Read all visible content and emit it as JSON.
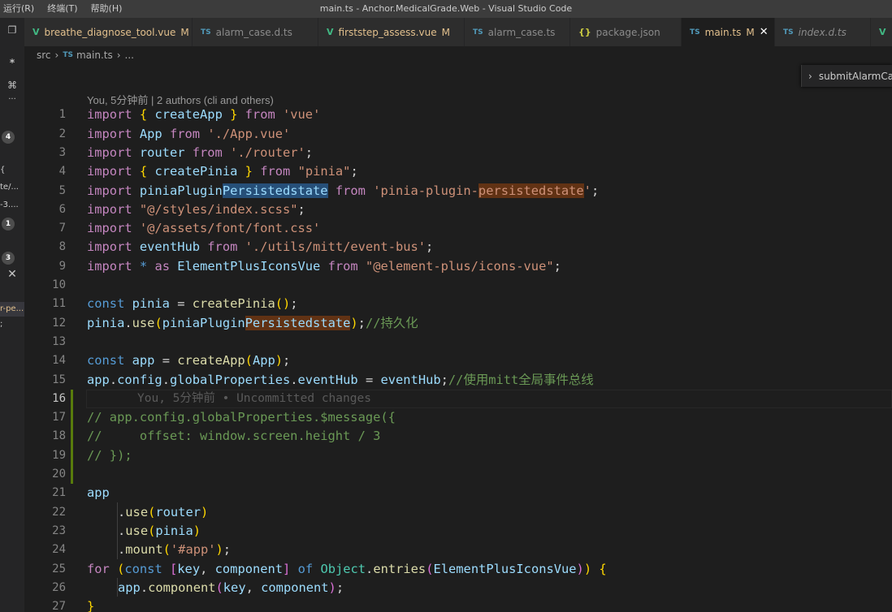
{
  "menu": [
    "运行(R)",
    "终端(T)",
    "帮助(H)"
  ],
  "window_title": "main.ts - Anchor.MedicalGrade.Web - Visual Studio Code",
  "activity": {
    "badges": [
      "4",
      "1",
      "3"
    ],
    "texts": [
      "{",
      "te/...",
      "-3....",
      "r-pe...",
      ";"
    ],
    "glyphs": [
      "copy-icon",
      "new-file-icon",
      "source-control-icon",
      "more-icon",
      "close-icon"
    ]
  },
  "tabs": [
    {
      "label": "breathe_diagnose_tool.vue",
      "icon": "V",
      "type": "vue",
      "status": "M"
    },
    {
      "label": "alarm_case.d.ts",
      "icon": "TS",
      "type": "ts",
      "status": ""
    },
    {
      "label": "firststep_assess.vue",
      "icon": "V",
      "type": "vue",
      "status": "M"
    },
    {
      "label": "alarm_case.ts",
      "icon": "TS",
      "type": "ts",
      "status": ""
    },
    {
      "label": "package.json",
      "icon": "{}",
      "type": "json",
      "status": ""
    },
    {
      "label": "main.ts",
      "icon": "TS",
      "type": "ts",
      "status": "M",
      "active": true
    },
    {
      "label": "index.d.ts",
      "icon": "TS",
      "type": "ts",
      "status": ""
    }
  ],
  "breadcrumb": {
    "folder": "src",
    "file_icon": "TS",
    "file": "main.ts",
    "more": "..."
  },
  "sticky": {
    "label": "submitAlarmCa"
  },
  "codelens": "You, 5分钟前 | 2 authors (cli and others)",
  "ghost_blame": "You, 5分钟前 • Uncommitted changes",
  "line_numbers": [
    "1",
    "2",
    "3",
    "4",
    "5",
    "6",
    "7",
    "8",
    "9",
    "10",
    "11",
    "12",
    "13",
    "14",
    "15",
    "16",
    "17",
    "18",
    "19",
    "20",
    "21",
    "22",
    "23",
    "24",
    "25",
    "26",
    "27"
  ],
  "code": {
    "l1": [
      "import",
      " ",
      "{",
      " createApp ",
      "}",
      " from ",
      "'vue'"
    ],
    "l2": [
      "import",
      " App ",
      "from",
      " ",
      "'./App.vue'"
    ],
    "l3": [
      "import",
      " router ",
      "from",
      " ",
      "'./router'",
      ";"
    ],
    "l4": [
      "import",
      " ",
      "{",
      " createPinia ",
      "}",
      " ",
      "from",
      " ",
      "\"pinia\"",
      ";"
    ],
    "l5": [
      "import",
      " piniaPlugin",
      "Persistedstate",
      " ",
      "from",
      " ",
      "'pinia-plugin-",
      "persistedstate",
      "'",
      ";"
    ],
    "l6": [
      "import",
      " ",
      "\"@/styles/index.scss\"",
      ";"
    ],
    "l7": [
      "import",
      " ",
      "'@/assets/font/font.css'"
    ],
    "l8": [
      "import",
      " eventHub ",
      "from",
      " ",
      "'./utils/mitt/event-bus'",
      ";"
    ],
    "l9": [
      "import",
      " ",
      "*",
      " ",
      "as",
      " ElementPlusIconsVue ",
      "from",
      " ",
      "\"@element-plus/icons-vue\"",
      ";"
    ],
    "l11": [
      "const",
      " pinia ",
      "=",
      " ",
      "createPinia",
      "()",
      ";"
    ],
    "l12": [
      "pinia",
      ".",
      "use",
      "(",
      "piniaPlugin",
      "Persistedstate",
      ")",
      ";",
      "//持久化"
    ],
    "l14": [
      "const",
      " app ",
      "=",
      " ",
      "createApp",
      "(",
      "App",
      ")",
      ";"
    ],
    "l15": [
      "app",
      ".",
      "config",
      ".",
      "globalProperties",
      ".",
      "eventHub",
      " = ",
      "eventHub",
      ";",
      "//使用mitt全局事件总线"
    ],
    "l17": "// app.config.globalProperties.$message({",
    "l18": "//     offset: window.screen.height / 3",
    "l19": "// });",
    "l21": "app",
    "l22": [
      ".",
      "use",
      "(",
      "router",
      ")"
    ],
    "l23": [
      ".",
      "use",
      "(",
      "pinia",
      ")"
    ],
    "l24": [
      ".",
      "mount",
      "(",
      "'#app'",
      ")",
      ";"
    ],
    "l25": [
      "for",
      " ",
      "(",
      "const",
      " ",
      "[",
      "key",
      ", ",
      "component",
      "]",
      " ",
      "of",
      " ",
      "Object",
      ".",
      "entries",
      "(",
      "ElementPlusIconsVue",
      ")",
      ")",
      " ",
      "{"
    ],
    "l26": [
      "app",
      ".",
      "component",
      "(",
      "key",
      ", ",
      "component",
      ")",
      ";"
    ],
    "l27": "}"
  }
}
